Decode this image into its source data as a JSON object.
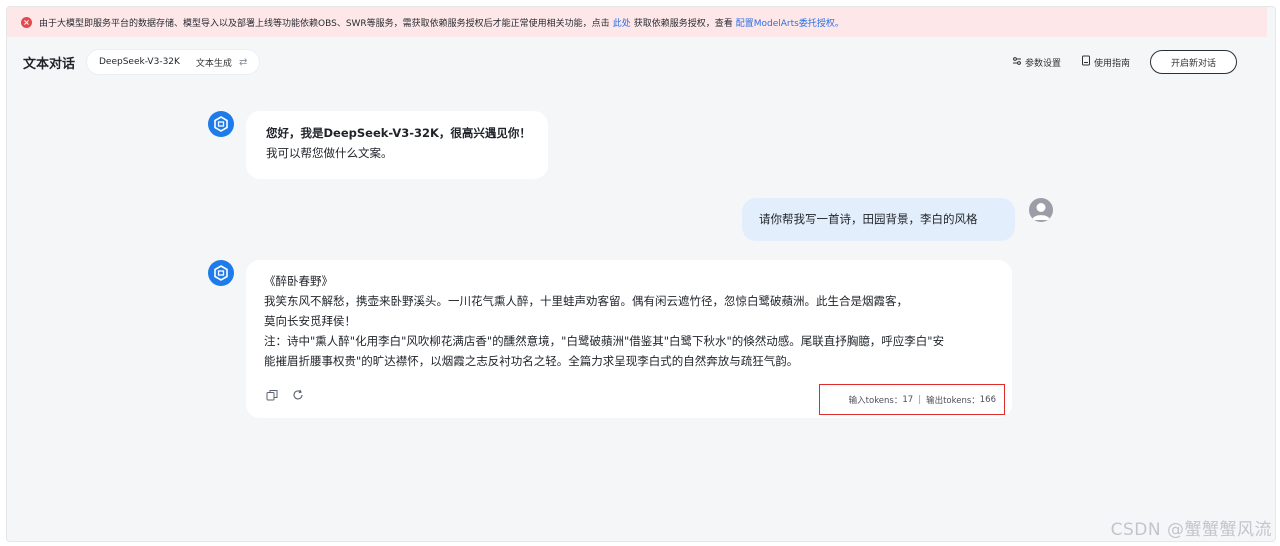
{
  "alert": {
    "text_before": "由于大模型即服务平台的数据存储、模型导入以及部署上线等功能依赖OBS、SWR等服务，需获取依赖服务授权后才能正常使用相关功能，点击",
    "link1": "此处",
    "text_middle": "获取依赖服务授权，查看",
    "link2": "配置ModelArts委托授权。",
    "icon": "error-icon",
    "color": "#e5484d"
  },
  "header": {
    "title": "文本对话",
    "model_name": "DeepSeek-V3-32K",
    "model_type": "文本生成",
    "swap_icon": "swap-icon",
    "params_label": "参数设置",
    "guide_label": "使用指南",
    "new_chat_label": "开启新对话"
  },
  "messages": {
    "greeting_line1": "您好，我是DeepSeek-V3-32K，很高兴遇见你！",
    "greeting_line2": "我可以帮您做什么文案。",
    "user_prompt": "请你帮我写一首诗，田园背景，李白的风格",
    "reply_title": "《醉卧春野》",
    "reply_line1": "我笑东风不解愁，携壶来卧野溪头。一川花气熏人醉，十里蛙声劝客留。偶有闲云遮竹径，忽惊白鹭破蘋洲。此生合是烟霞客，",
    "reply_line2": "莫向长安觅拜侯！",
    "reply_line3": "注：诗中\"熏人醉\"化用李白\"风吹柳花满店香\"的醺然意境，\"白鹭破蘋洲\"借鉴其\"白鹭下秋水\"的倏然动感。尾联直抒胸臆，呼应李白\"安",
    "reply_line4": "能摧眉折腰事权贵\"的旷达襟怀，以烟霞之志反衬功名之轻。全篇力求呈现李白式的自然奔放与疏狂气韵。"
  },
  "tokens": {
    "input_label": "输入tokens：",
    "input_value": "17",
    "separator": "|",
    "output_label": "输出tokens：",
    "output_value": "166"
  },
  "watermark": "CSDN @蟹蟹蟹风流",
  "colors": {
    "accent": "#1e7bea",
    "user_bubble": "#e3eefc",
    "highlight_border": "#e02b2b"
  }
}
